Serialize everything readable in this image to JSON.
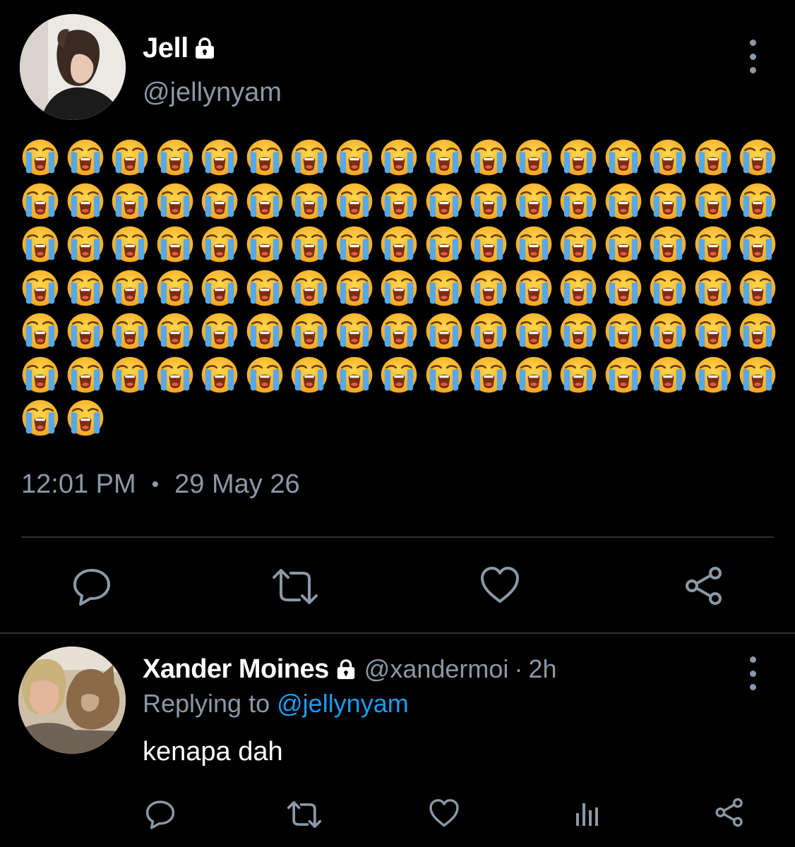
{
  "main_tweet": {
    "display_name": "Jell",
    "handle": "@jellynyam",
    "protected": true,
    "emoji": "😭",
    "emoji_count": 104,
    "time": "12:01 PM",
    "separator": "•",
    "date": "29 May 26"
  },
  "reply": {
    "display_name": "Xander Moines",
    "protected": true,
    "handle": "@xandermoi",
    "separator": "·",
    "age": "2h",
    "replying_prefix": "Replying to",
    "replying_to": "@jellynyam",
    "text": "kenapa dah"
  },
  "icons": {
    "lock": "lock-icon",
    "more": "more-vertical-icon",
    "reply": "reply-icon",
    "retweet": "retweet-icon",
    "like": "like-icon",
    "share": "share-icon",
    "analytics": "analytics-icon"
  },
  "colors": {
    "background": "#000000",
    "primary_text": "#ffffff",
    "secondary_text": "#8b98a5",
    "link": "#1d9bf0",
    "divider": "#2f3336"
  }
}
